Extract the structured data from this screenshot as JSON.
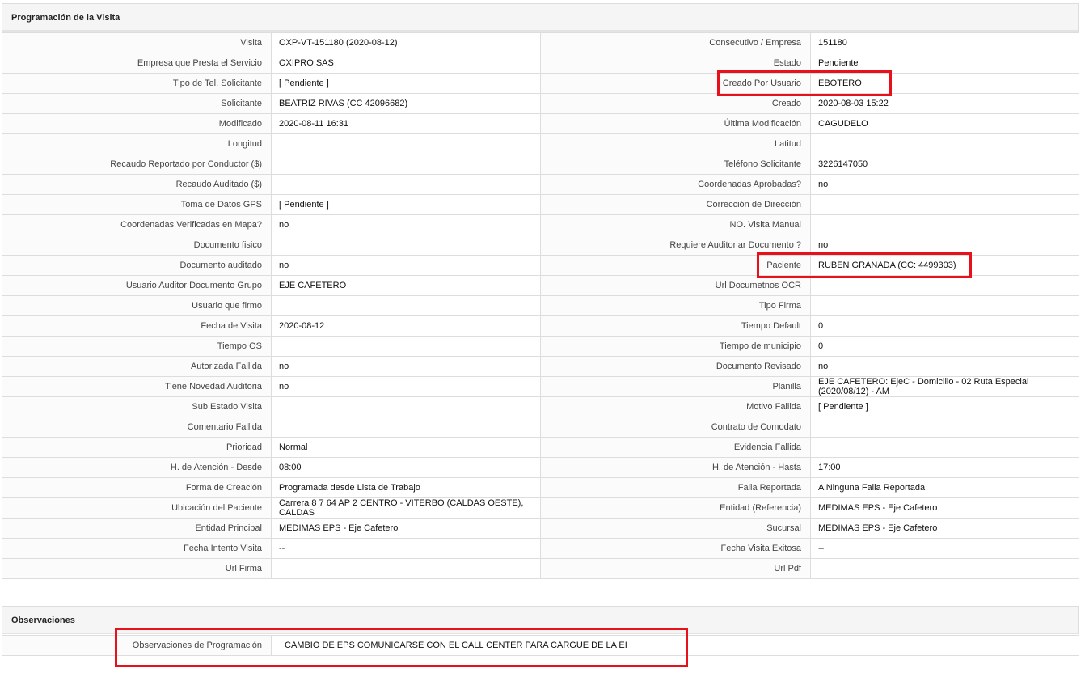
{
  "visit_section": {
    "title": "Programación de la Visita",
    "rows": [
      {
        "left_label": "Visita",
        "left_value": "OXP-VT-151180 (2020-08-12)",
        "right_label": "Consecutivo / Empresa",
        "right_value": "151180"
      },
      {
        "left_label": "Empresa que Presta el Servicio",
        "left_value": "OXIPRO SAS",
        "right_label": "Estado",
        "right_value": "Pendiente"
      },
      {
        "left_label": "Tipo de Tel. Solicitante",
        "left_value": "[ Pendiente ]",
        "right_label": "Creado Por Usuario",
        "right_value": "EBOTERO"
      },
      {
        "left_label": "Solicitante",
        "left_value": "BEATRIZ RIVAS (CC 42096682)",
        "right_label": "Creado",
        "right_value": "2020-08-03 15:22"
      },
      {
        "left_label": "Modificado",
        "left_value": "2020-08-11 16:31",
        "right_label": "Última Modificación",
        "right_value": " CAGUDELO"
      },
      {
        "left_label": "Longitud",
        "left_value": "",
        "right_label": "Latitud",
        "right_value": ""
      },
      {
        "left_label": "Recaudo Reportado por Conductor ($)",
        "left_value": "",
        "right_label": "Teléfono Solicitante",
        "right_value": "3226147050"
      },
      {
        "left_label": "Recaudo Auditado ($)",
        "left_value": "",
        "right_label": "Coordenadas Aprobadas?",
        "right_value": " no"
      },
      {
        "left_label": "Toma de Datos GPS",
        "left_value": "[ Pendiente ]",
        "right_label": "Corrección de Dirección",
        "right_value": ""
      },
      {
        "left_label": "Coordenadas Verificadas en Mapa?",
        "left_value": " no",
        "right_label": "NO. Visita Manual",
        "right_value": ""
      },
      {
        "left_label": "Documento fisico",
        "left_value": "",
        "right_label": "Requiere Auditoriar Documento ?",
        "right_value": " no"
      },
      {
        "left_label": "Documento auditado",
        "left_value": " no",
        "right_label": "Paciente",
        "right_value": "RUBEN GRANADA (CC: 4499303)"
      },
      {
        "left_label": "Usuario Auditor Documento Grupo",
        "left_value": "EJE CAFETERO",
        "right_label": "Url Documetnos OCR",
        "right_value": ""
      },
      {
        "left_label": "Usuario que firmo",
        "left_value": "",
        "right_label": "Tipo Firma",
        "right_value": ""
      },
      {
        "left_label": "Fecha de Visita",
        "left_value": " 2020-08-12",
        "right_label": "Tiempo Default",
        "right_value": "0"
      },
      {
        "left_label": "Tiempo OS",
        "left_value": "",
        "right_label": "Tiempo de municipio",
        "right_value": "0"
      },
      {
        "left_label": "Autorizada Fallida",
        "left_value": " no",
        "right_label": "Documento Revisado",
        "right_value": " no"
      },
      {
        "left_label": "Tiene Novedad Auditoria",
        "left_value": " no",
        "right_label": "Planilla",
        "right_value": "EJE CAFETERO: EjeC - Domicilio - 02 Ruta Especial (2020/08/12) - AM"
      },
      {
        "left_label": "Sub Estado Visita",
        "left_value": "",
        "right_label": "Motivo Fallida",
        "right_value": "[ Pendiente ]"
      },
      {
        "left_label": "Comentario Fallida",
        "left_value": "",
        "right_label": "Contrato de Comodato",
        "right_value": ""
      },
      {
        "left_label": "Prioridad",
        "left_value": "Normal",
        "right_label": "Evidencia Fallida",
        "right_value": ""
      },
      {
        "left_label": "H. de Atención - Desde",
        "left_value": "08:00",
        "right_label": "H. de Atención - Hasta",
        "right_value": "17:00"
      },
      {
        "left_label": "Forma de Creación",
        "left_value": "Programada desde Lista de Trabajo",
        "right_label": "Falla Reportada",
        "right_value": "A Ninguna Falla Reportada"
      },
      {
        "left_label": "Ubicación del Paciente",
        "left_value": "Carrera 8 7 64 AP 2 CENTRO - VITERBO (CALDAS OESTE), CALDAS",
        "right_label": "Entidad (Referencia)",
        "right_value": "MEDIMAS EPS - Eje Cafetero"
      },
      {
        "left_label": "Entidad Principal",
        "left_value": "MEDIMAS EPS - Eje Cafetero",
        "right_label": "Sucursal",
        "right_value": "MEDIMAS EPS - Eje Cafetero"
      },
      {
        "left_label": "Fecha Intento Visita",
        "left_value": " --",
        "right_label": "Fecha Visita Exitosa",
        "right_value": " --"
      },
      {
        "left_label": "Url Firma",
        "left_value": "",
        "right_label": "Url Pdf",
        "right_value": ""
      }
    ]
  },
  "observations_section": {
    "title": "Observaciones",
    "label": "Observaciones de Programación",
    "value": "CAMBIO DE EPS COMUNICARSE CON EL CALL CENTER PARA CARGUE DE LA EI"
  },
  "colors": {
    "highlight": "#e8101b",
    "header_background": "#f5f5f5",
    "border": "#dddddd"
  }
}
